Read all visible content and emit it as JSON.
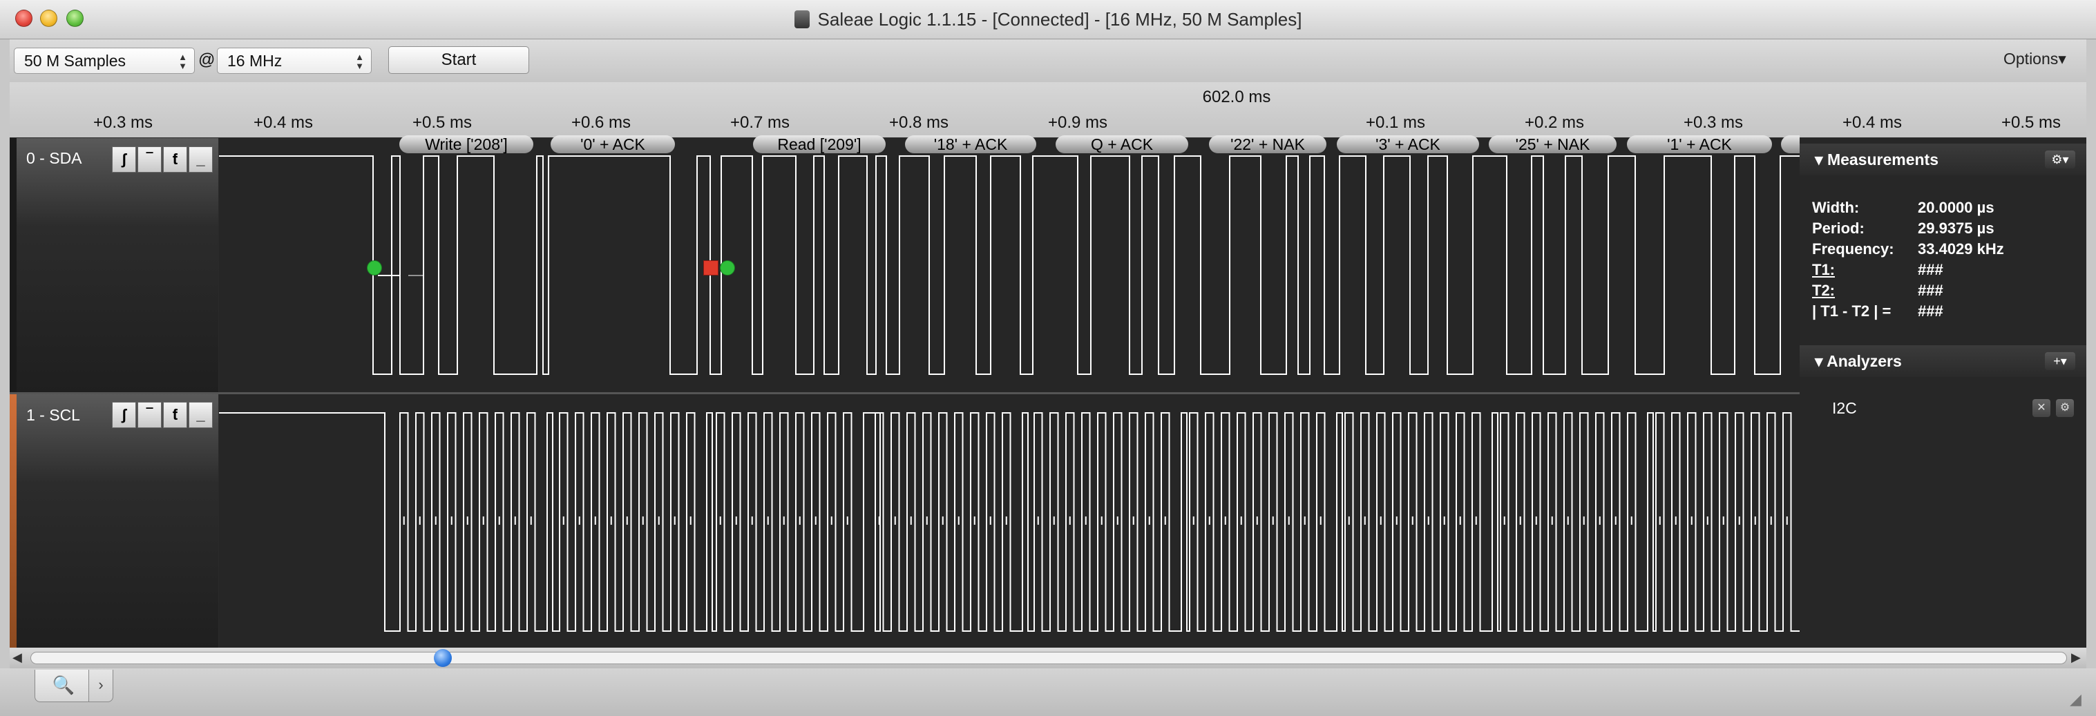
{
  "window": {
    "title": "Saleae Logic 1.1.15 - [Connected] - [16 MHz, 50 M Samples]"
  },
  "toolbar": {
    "samples_value": "50 M Samples",
    "at_label": "@",
    "rate_value": "16 MHz",
    "start_label": "Start",
    "options_label": "Options▾"
  },
  "ruler": {
    "center_label": "602.0 ms",
    "ticks": [
      "+0.3 ms",
      "+0.4 ms",
      "+0.5 ms",
      "+0.6 ms",
      "+0.7 ms",
      "+0.8 ms",
      "+0.9 ms",
      "+0.1 ms",
      "+0.2 ms",
      "+0.3 ms",
      "+0.4 ms",
      "+0.5 ms"
    ]
  },
  "channels": [
    {
      "name": "0 - SDA"
    },
    {
      "name": "1 - SCL"
    }
  ],
  "trigger_buttons": {
    "rising": "ʃ",
    "high": "‾",
    "falling": "ƭ",
    "low": "_"
  },
  "decoded": [
    "Write ['208']",
    "'0' + ACK",
    "Read ['209']",
    "'18' + ACK",
    "Q + ACK",
    "'22' + NAK",
    "'3' + ACK",
    "'25' + NAK",
    "'1' + ACK"
  ],
  "measurements": {
    "title": "Measurements",
    "rows": [
      {
        "label": "Width:",
        "value": "20.0000 µs"
      },
      {
        "label": "Period:",
        "value": "29.9375 µs"
      },
      {
        "label": "Frequency:",
        "value": "33.4029 kHz"
      },
      {
        "label": "T1:",
        "value": "###"
      },
      {
        "label": "T2:",
        "value": "###"
      },
      {
        "label": "| T1 - T2 | =",
        "value": "###"
      }
    ]
  },
  "analyzers": {
    "title": "Analyzers",
    "items": [
      "I2C"
    ]
  },
  "scroll": {
    "position": 0.2
  },
  "colors": {
    "wave": "#ffffff",
    "marker_green": "#2fbf3a",
    "marker_red": "#e03a2a",
    "scl_accent": "#d0703a"
  }
}
